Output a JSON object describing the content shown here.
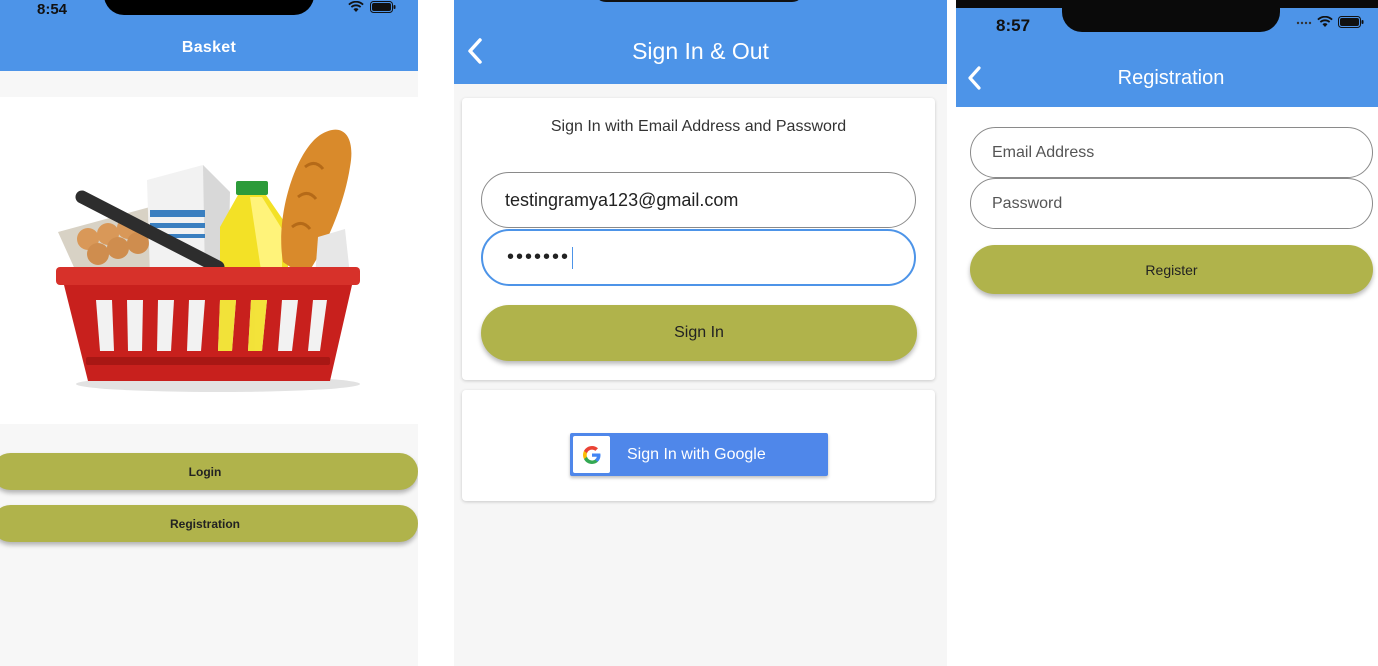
{
  "colors": {
    "appbar": "#4d94e8",
    "button": "#b0b34b",
    "google_button": "#4f87ea"
  },
  "basket": {
    "status_time": "8:54",
    "title": "Basket",
    "hero_image": "grocery-basket-illustration",
    "login_label": "Login",
    "registration_label": "Registration"
  },
  "signin": {
    "title": "Sign In & Out",
    "heading": "Sign In with Email Address and Password",
    "email_value": "testingramya123@gmail.com",
    "password_value": "•••••••",
    "signin_label": "Sign In",
    "google_label": "Sign In with Google",
    "google_icon": "G"
  },
  "registration": {
    "status_time": "8:57",
    "title": "Registration",
    "email_placeholder": "Email Address",
    "password_placeholder": "Password",
    "register_label": "Register"
  }
}
